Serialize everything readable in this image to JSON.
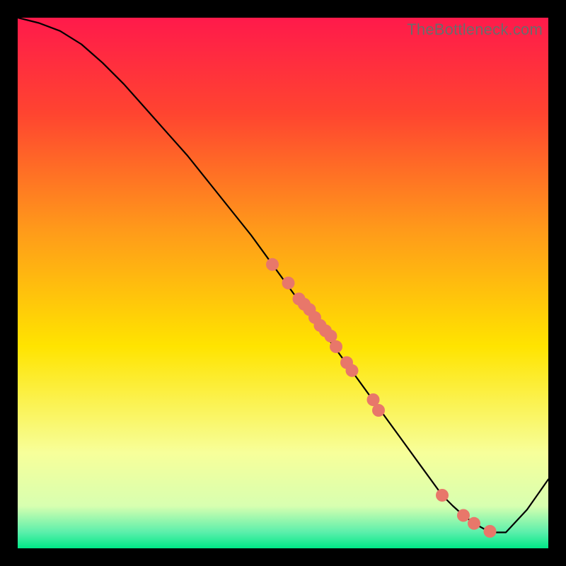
{
  "watermark": "TheBottleneck.com",
  "chart_data": {
    "type": "line",
    "title": "",
    "xlabel": "",
    "ylabel": "",
    "xlim": [
      0,
      100
    ],
    "ylim": [
      0,
      100
    ],
    "grid": false,
    "legend": false,
    "background_gradient": {
      "top_color": "#ff1a4b",
      "mid_color": "#ffe400",
      "near_bottom_color": "#f7ff9a",
      "bottom_band_color": "#00e887"
    },
    "series": [
      {
        "name": "bottleneck-curve",
        "type": "line",
        "color": "#000000",
        "x": [
          0,
          4,
          8,
          12,
          16,
          20,
          24,
          28,
          32,
          36,
          40,
          44,
          48,
          52,
          56,
          60,
          64,
          68,
          72,
          76,
          80,
          82,
          84,
          86,
          88,
          90,
          92,
          96,
          100
        ],
        "y": [
          100,
          99,
          97.5,
          95,
          91.5,
          87.5,
          83,
          78.5,
          74,
          69,
          64,
          59,
          53.5,
          48,
          43,
          37.5,
          32,
          26.5,
          21,
          15.5,
          10,
          8,
          6.2,
          4.7,
          3.6,
          3,
          3,
          7.3,
          13
        ]
      },
      {
        "name": "highlighted-points",
        "type": "scatter",
        "color": "#e8776a",
        "marker": "circle",
        "x": [
          48,
          51,
          53,
          54,
          55,
          56,
          57,
          58,
          59,
          60,
          62,
          63,
          67,
          68,
          80,
          84,
          86,
          89
        ],
        "y": [
          53.5,
          50,
          47,
          46,
          45,
          43.5,
          42,
          41,
          40,
          38,
          35,
          33.5,
          28,
          26,
          10,
          6.2,
          4.7,
          3.2
        ]
      }
    ]
  }
}
